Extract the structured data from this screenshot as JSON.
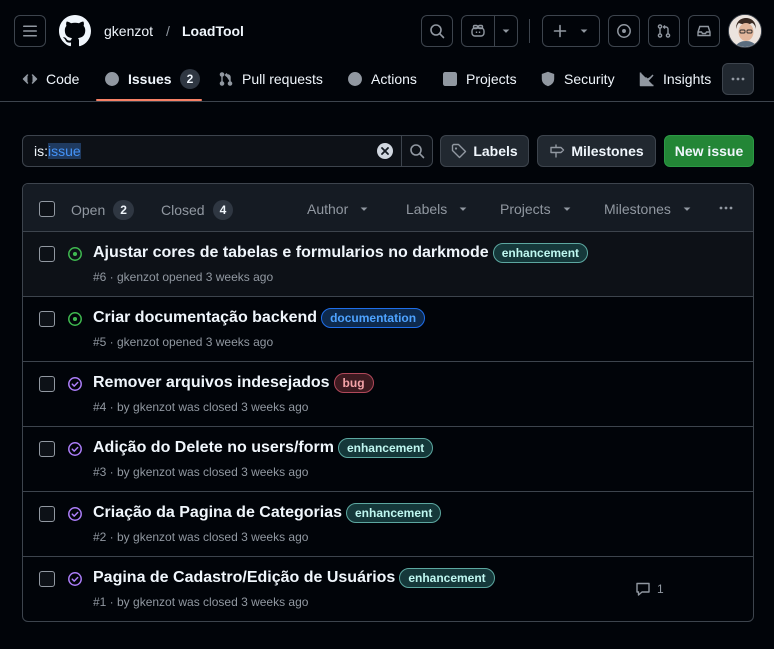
{
  "header": {
    "owner": "gkenzot",
    "separator": "/",
    "repo": "LoadTool"
  },
  "tabs": [
    {
      "label": "Code"
    },
    {
      "label": "Issues",
      "count": "2",
      "selected": true
    },
    {
      "label": "Pull requests"
    },
    {
      "label": "Actions"
    },
    {
      "label": "Projects"
    },
    {
      "label": "Security"
    },
    {
      "label": "Insights"
    }
  ],
  "search": {
    "prefix": "is:",
    "highlight": "issue"
  },
  "buttons": {
    "labels": "Labels",
    "milestones": "Milestones",
    "new_issue": "New issue"
  },
  "list_header": {
    "open_label": "Open",
    "open_count": "2",
    "closed_label": "Closed",
    "closed_count": "4",
    "filters": [
      "Author",
      "Labels",
      "Projects",
      "Milestones"
    ]
  },
  "issues": [
    {
      "title": "Ajustar cores de tabelas e formularios no darkmode",
      "label": "enhancement",
      "meta": "#6 · gkenzot opened 3 weeks ago",
      "state": "open"
    },
    {
      "title": "Criar documentação backend",
      "label": "documentation",
      "meta": "#5 · gkenzot opened 3 weeks ago",
      "state": "open"
    },
    {
      "title": "Remover arquivos indesejados",
      "label": "bug",
      "meta": "#4 · by gkenzot was closed 3 weeks ago",
      "state": "closed"
    },
    {
      "title": "Adição do Delete no users/form",
      "label": "enhancement",
      "meta": "#3 · by gkenzot was closed 3 weeks ago",
      "state": "closed"
    },
    {
      "title": "Criação da Pagina de Categorias",
      "label": "enhancement",
      "meta": "#2 · by gkenzot was closed 3 weeks ago",
      "state": "closed"
    },
    {
      "title": "Pagina de Cadastro/Edição de Usuários",
      "label": "enhancement",
      "meta": "#1 · by gkenzot was closed 3 weeks ago",
      "state": "closed",
      "comments": "1"
    }
  ],
  "colors": {
    "open": "#3fb950",
    "closed": "#ab7df8",
    "primary": "#238636",
    "accent_underline": "#f78166"
  }
}
